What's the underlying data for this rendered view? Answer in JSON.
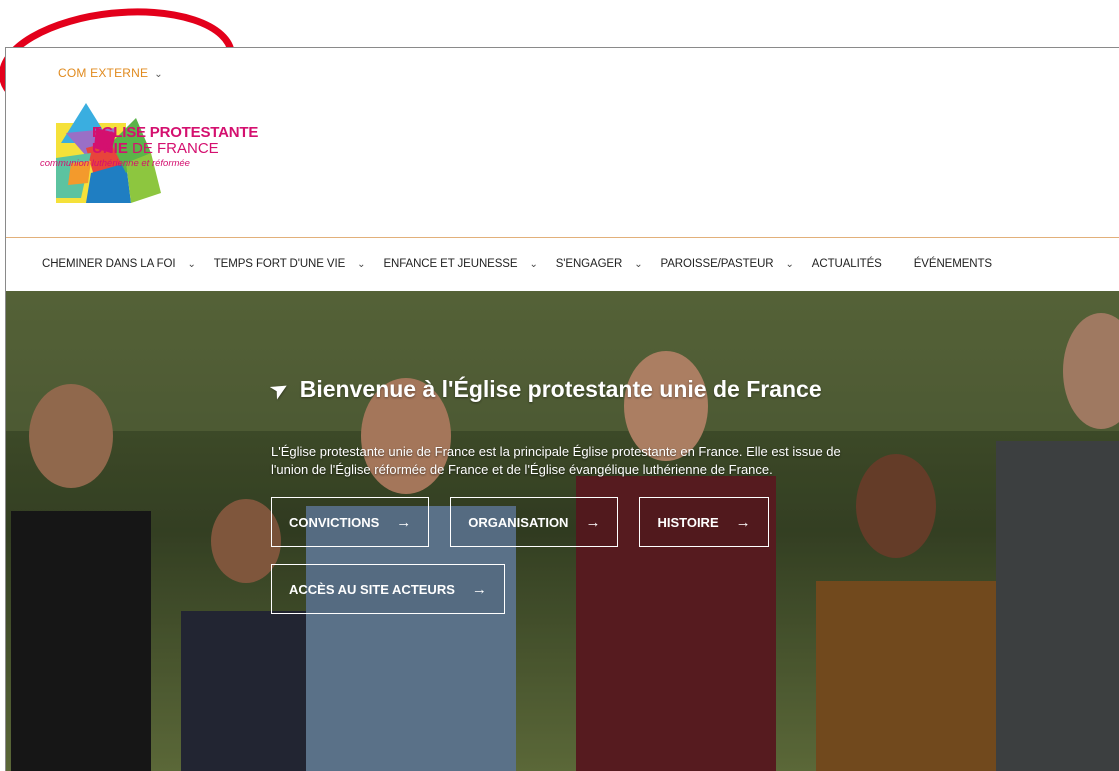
{
  "topbar": {
    "label": "COM EXTERNE"
  },
  "logo": {
    "line1": "EGLISE PROTESTANTE",
    "line2_bold": "UNIE",
    "line2_rest": " DE FRANCE",
    "tagline": "communion luthérienne et réformée"
  },
  "nav": {
    "items": [
      {
        "label": "CHEMINER DANS LA FOI",
        "has_dropdown": true
      },
      {
        "label": "TEMPS FORT D'UNE VIE",
        "has_dropdown": true
      },
      {
        "label": "ENFANCE ET JEUNESSE",
        "has_dropdown": true
      },
      {
        "label": "S'ENGAGER",
        "has_dropdown": true
      },
      {
        "label": "PAROISSE/PASTEUR",
        "has_dropdown": true
      },
      {
        "label": "ACTUALITÉS",
        "has_dropdown": false
      },
      {
        "label": "ÉVÉNEMENTS",
        "has_dropdown": false
      }
    ]
  },
  "hero": {
    "title": "Bienvenue à l'Église protestante unie de France",
    "description": "L'Église protestante unie de France est la principale Église protestante en France. Elle est issue de l'union de l'Église réformée de France et de l'Église évangélique luthérienne de France.",
    "buttons": [
      "CONVICTIONS",
      "ORGANISATION",
      "HISTOIRE"
    ],
    "button2": "ACCÈS AU SITE ACTEURS"
  },
  "colors": {
    "accent": "#e08a1e",
    "brand": "#d4106f",
    "annotation": "#e3001b"
  }
}
